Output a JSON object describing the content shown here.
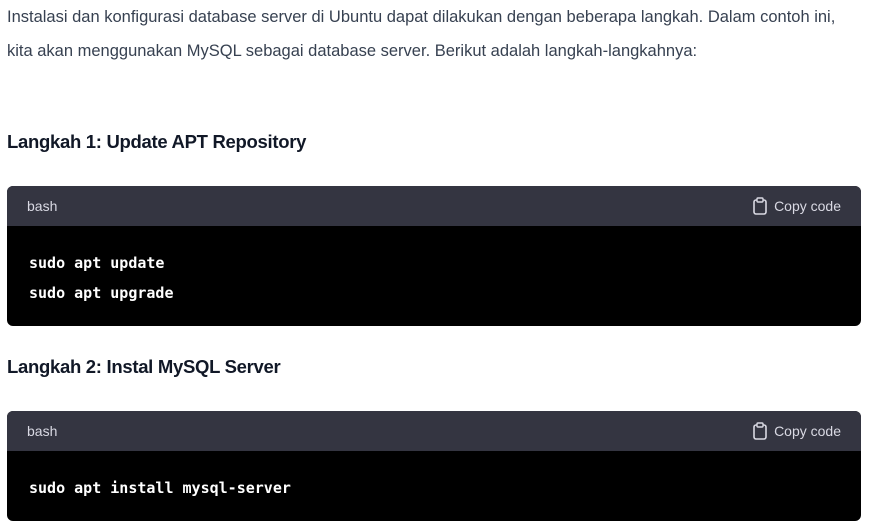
{
  "intro": "Instalasi dan konfigurasi database server di Ubuntu dapat dilakukan dengan beberapa langkah. Dalam contoh ini, kita akan menggunakan MySQL sebagai database server. Berikut adalah langkah-langkahnya:",
  "steps": [
    {
      "heading": "Langkah 1: Update APT Repository",
      "language": "bash",
      "copy_label": "Copy code",
      "code": "sudo apt update\nsudo apt upgrade"
    },
    {
      "heading": "Langkah 2: Instal MySQL Server",
      "language": "bash",
      "copy_label": "Copy code",
      "code": "sudo apt install mysql-server"
    }
  ]
}
